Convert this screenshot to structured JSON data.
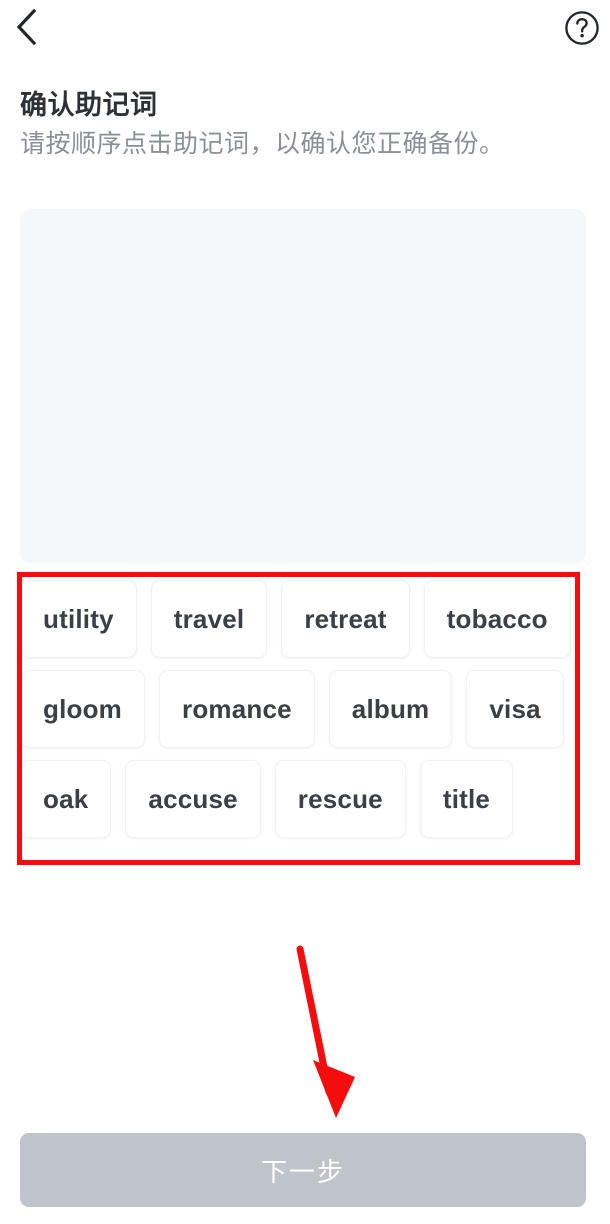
{
  "header": {
    "back_icon": "chevron-left-icon",
    "help_icon": "question-mark-circle-icon"
  },
  "heading": {
    "title": "确认助记词",
    "subtitle": "请按顺序点击助记词，以确认您正确备份。"
  },
  "dropzone": {
    "selected_words": [],
    "background_color": "#f5f8fb"
  },
  "word_pool": {
    "rows": [
      [
        "utility",
        "travel",
        "retreat",
        "tobacco"
      ],
      [
        "gloom",
        "romance",
        "album",
        "visa"
      ],
      [
        "oak",
        "accuse",
        "rescue",
        "title"
      ]
    ]
  },
  "footer": {
    "next_label": "下一步",
    "next_disabled_color": "#bfc3ca",
    "next_text_color": "#ffffff"
  },
  "annotations": {
    "highlight_color": "#f50d0d",
    "rect_target": "word-pool",
    "arrow_target": "next-button"
  }
}
